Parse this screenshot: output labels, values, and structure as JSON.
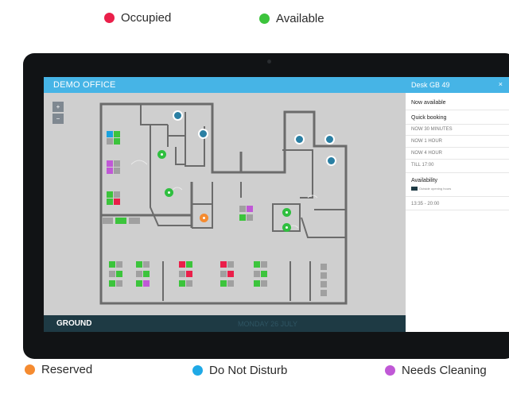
{
  "legend": {
    "occupied": {
      "label": "Occupied",
      "color": "#ea1f4a"
    },
    "available": {
      "label": "Available",
      "color": "#3cc43c"
    },
    "reserved": {
      "label": "Reserved",
      "color": "#f58b30"
    },
    "do_not_disturb": {
      "label": "Do Not Disturb",
      "color": "#1fa9e6"
    },
    "needs_cleaning": {
      "label": "Needs Cleaning",
      "color": "#c058d6"
    }
  },
  "app": {
    "title": "DEMO OFFICE",
    "floor": "GROUND",
    "date": "MONDAY 26 JULY",
    "zoom_in": "+",
    "zoom_out": "−"
  },
  "panel": {
    "title": "Desk GB 49",
    "close": "×",
    "status": "Now available",
    "quick_booking_heading": "Quick booking",
    "quick_booking_options": [
      "NOW 30 MINUTES",
      "NOW 1 HOUR",
      "NOW 4 HOUR",
      "TILL 17:00"
    ],
    "availability_heading": "Availability",
    "availability_note": "Outside opening hours",
    "availability_slot": "13:35 - 20:00"
  },
  "icons": {
    "desk": "desk-icon",
    "meeting": "meeting-pod-icon",
    "wc": "restroom-icon",
    "kitchen": "kitchen-icon"
  }
}
